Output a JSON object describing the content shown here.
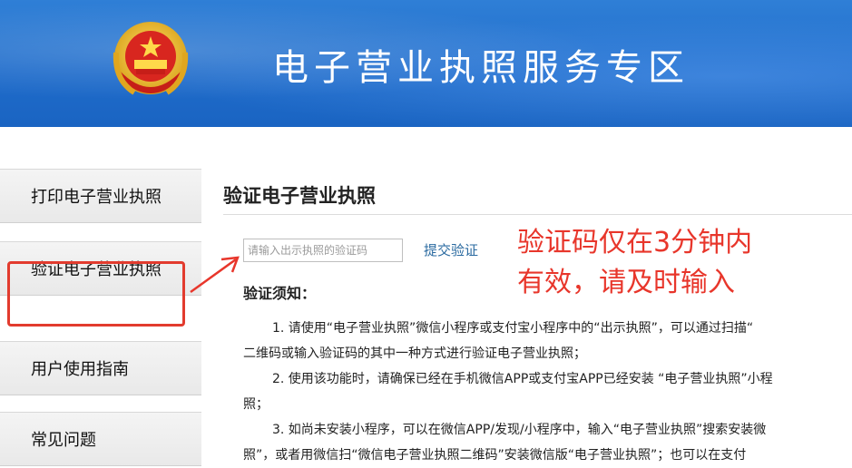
{
  "header": {
    "title": "电子营业执照服务专区",
    "emblem_icon": "national-emblem-icon",
    "colors": {
      "banner": "#1f6ccb",
      "title": "#ffffff"
    }
  },
  "sidebar": {
    "items": [
      {
        "label": "打印电子营业执照",
        "active": false
      },
      {
        "label": "验证电子营业执照",
        "active": true
      },
      {
        "label": "用户使用指南",
        "active": false
      },
      {
        "label": "常见问题",
        "active": false
      }
    ]
  },
  "main": {
    "title": "验证电子营业执照",
    "input": {
      "placeholder": "请输入出示执照的验证码",
      "value": ""
    },
    "submit_label": "提交验证",
    "annotation": {
      "line1": "验证码仅在3分钟内",
      "line2": "有效，请及时输入",
      "color": "#e8362b"
    },
    "notes_heading": "验证须知：",
    "notes_lines": [
      "1. 请使用“电子营业执照”微信小程序或支付宝小程序中的“出示执照”，可以通过扫描“",
      "二维码或输入验证码的其中一种方式进行验证电子营业执照；",
      "2. 使用该功能时，请确保已经在手机微信APP或支付宝APP已经安装 “电子营业执照”小程",
      "照；",
      "3. 如尚未安装小程序，可以在微信APP/发现/小程序中，输入“电子营业执照”搜索安装微",
      "照”，或者用微信扫“微信电子营业执照二维码”安装微信版“电子营业执照”；也可以在支付"
    ]
  }
}
